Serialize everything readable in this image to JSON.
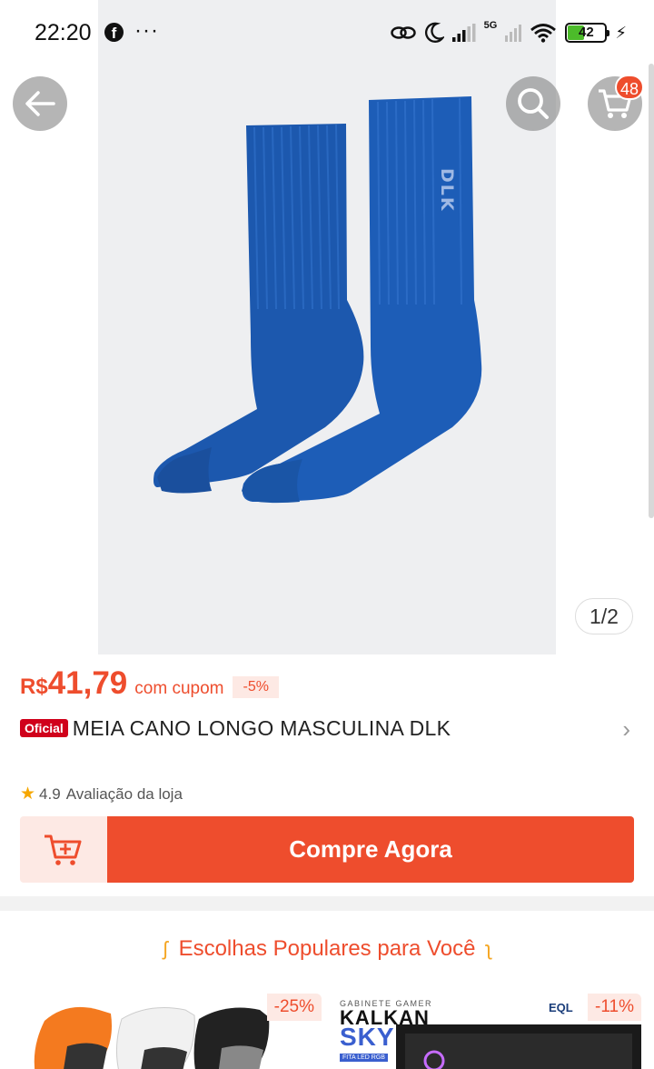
{
  "status_bar": {
    "time": "22:20",
    "network": "5G",
    "battery": "42"
  },
  "product": {
    "image_counter": "1/2",
    "cart_count": "48",
    "price_currency": "R$",
    "price_value": "41,79",
    "price_note": "com cupom",
    "discount": "-5%",
    "official_label": "Oficial",
    "title": "MEIA CANO LONGO MASCULINA DLK",
    "rating": "4.9",
    "rating_label": "Avaliação da loja",
    "buy_label": "Compre Agora",
    "sock_brand": "DLK"
  },
  "popular": {
    "header": "Escolhas Populares para Você",
    "items": [
      {
        "discount": "-25%"
      },
      {
        "discount": "-11%",
        "title_top": "GABINETE GAMER",
        "title_main": "KALKAN",
        "title_sub": "SKYE",
        "badge": "FITA LED RGB",
        "brand": "EQL"
      }
    ]
  },
  "colors": {
    "accent": "#ee4d2d",
    "sock_blue": "#1d5db7",
    "official_red": "#d0011b"
  }
}
